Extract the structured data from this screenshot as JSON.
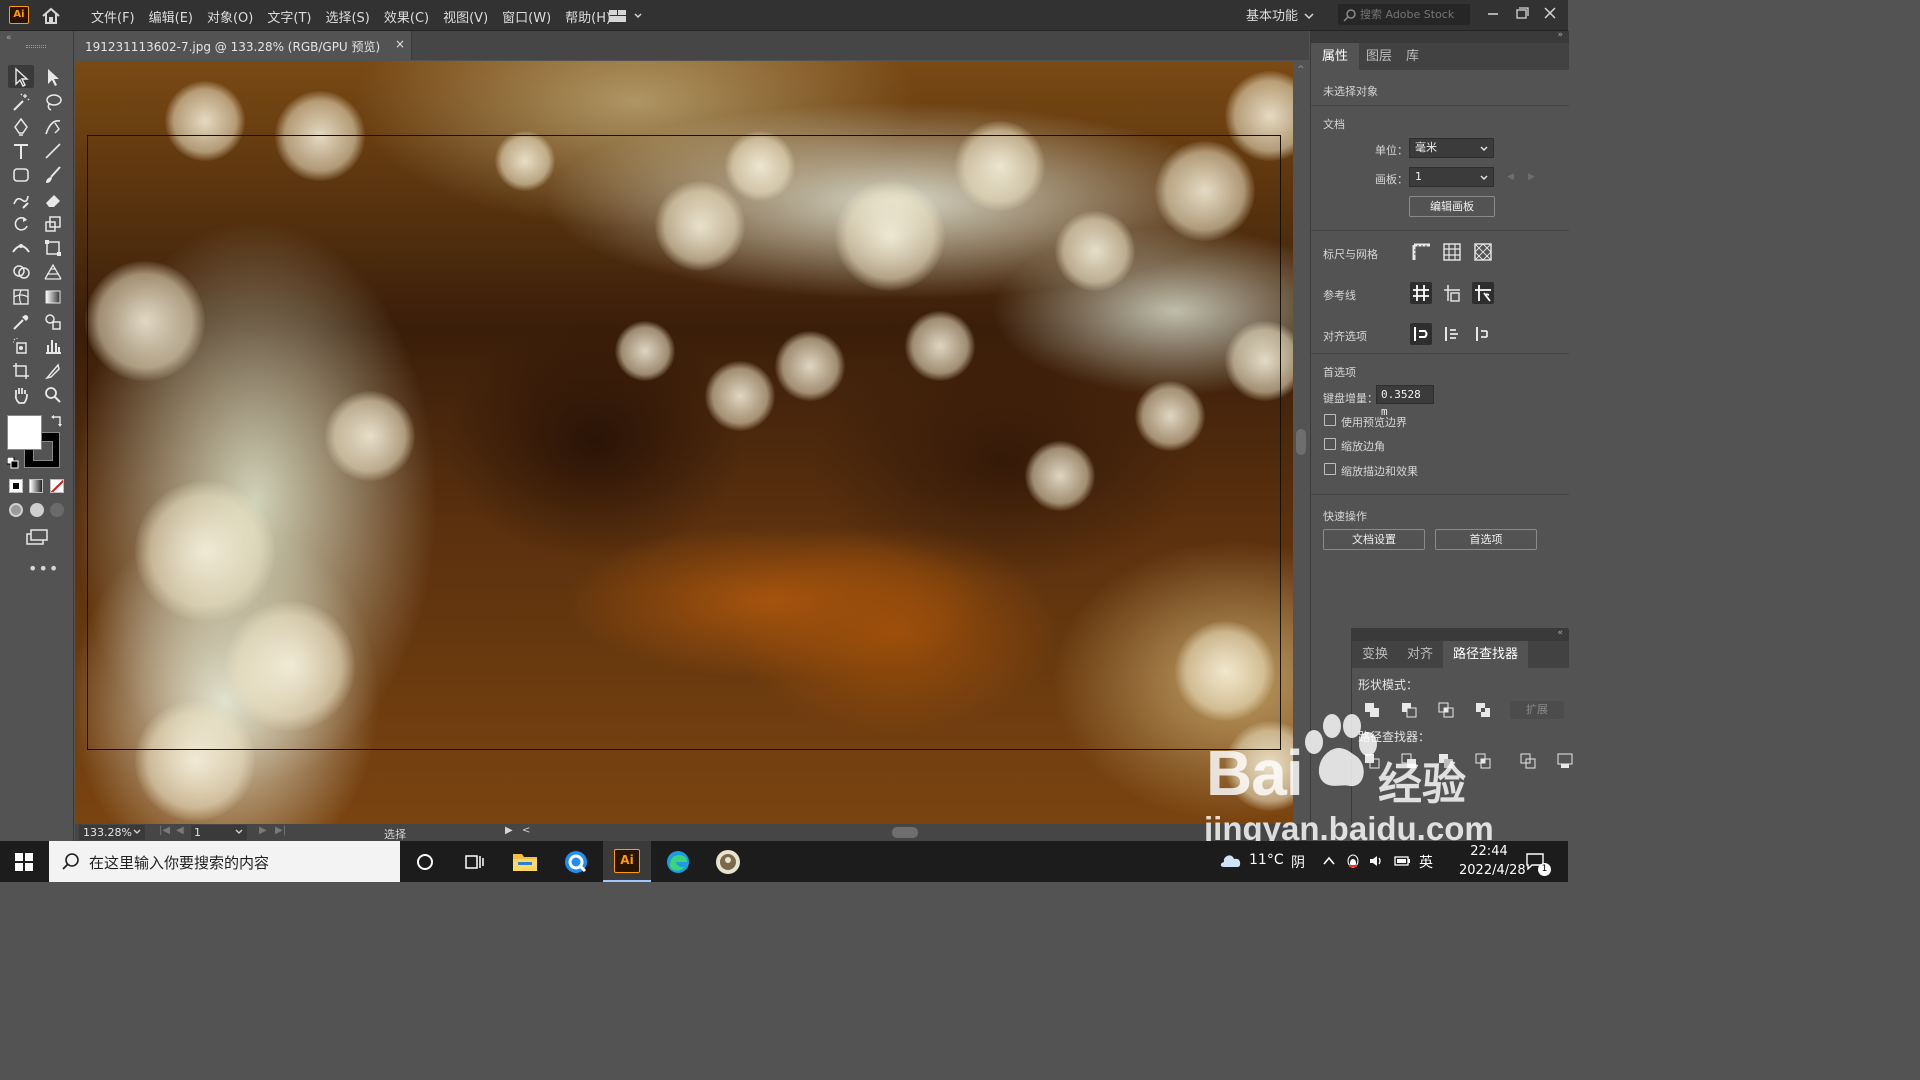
{
  "app": {
    "logo_text": "Ai",
    "menus": [
      "文件(F)",
      "编辑(E)",
      "对象(O)",
      "文字(T)",
      "选择(S)",
      "效果(C)",
      "视图(V)",
      "窗口(W)",
      "帮助(H)"
    ],
    "workspace": "基本功能",
    "stock_search_placeholder": "搜索 Adobe Stock"
  },
  "document": {
    "tab_title": "191231113602-7.jpg @ 133.28% (RGB/GPU 预览)",
    "close_glyph": "×"
  },
  "statusbar": {
    "zoom": "133.28%",
    "artboard": "1",
    "status_text": "选择"
  },
  "properties_panel": {
    "tabs": [
      "属性",
      "图层",
      "库"
    ],
    "active_tab": "属性",
    "no_selection": "未选择对象",
    "doc_section": "文档",
    "units_label": "单位：",
    "units_value": "毫米",
    "artboard_label": "画板：",
    "artboard_value": "1",
    "edit_artboards": "编辑画板",
    "rulers_grids": "标尺与网格",
    "guides": "参考线",
    "snap_options": "对齐选项",
    "preferences_section": "首选项",
    "keyboard_increment_label": "键盘增量：",
    "keyboard_increment_value": "0.3528 m",
    "checkboxes": [
      "使用预览边界",
      "缩放边角",
      "缩放描边和效果"
    ],
    "quick_actions": "快速操作",
    "doc_setup_button": "文档设置",
    "preferences_button": "首选项"
  },
  "pathfinder_panel": {
    "tabs": [
      "变换",
      "对齐",
      "路径查找器"
    ],
    "active_tab": "路径查找器",
    "shape_modes": "形状模式：",
    "pathfinders": "路径查找器：",
    "expand": "扩展"
  },
  "watermark": {
    "brand_left": "Bai",
    "brand_right": "经验",
    "url": "jingyan.baidu.com"
  },
  "taskbar": {
    "search_placeholder": "在这里输入你要搜索的内容",
    "temperature": "11°C",
    "condition": "阴",
    "ime": "英",
    "time": "22:44",
    "date": "2022/4/28",
    "notification_count": "1"
  }
}
